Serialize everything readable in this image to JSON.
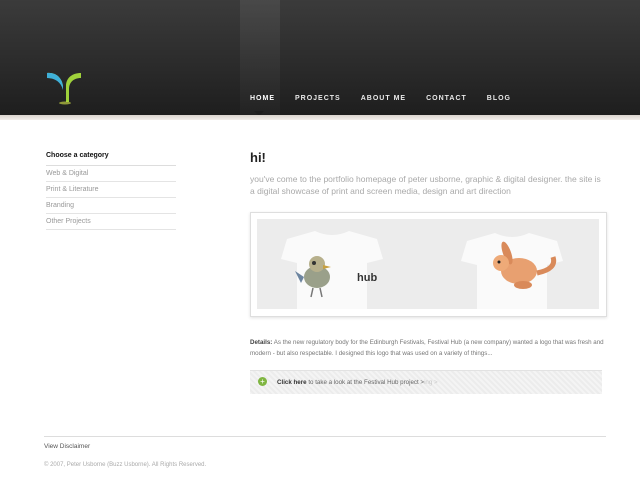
{
  "header": {
    "logo_icon": "y-logo-icon",
    "nav": [
      "HOME",
      "PROJECTS",
      "ABOUT ME",
      "CONTACT",
      "BLOG"
    ],
    "active": "HOME"
  },
  "sidebar": {
    "title": "Choose a category",
    "items": [
      "Web & Digital",
      "Print & Literature",
      "Branding",
      "Other Projects"
    ]
  },
  "main": {
    "greeting": "hi!",
    "intro": "you've come to the portfolio homepage of peter usborne, graphic & digital designer. the site is a digital showcase of print and screen media, design and art direction",
    "feature_logo_text": "hub",
    "details_label": "Details:",
    "details_text": "As the new regulatory body for the Edinburgh Festivals, Festival Hub (a new company) wanted a logo that was fresh and modern - but also respectable. I designed this logo that was used on a variety of things...",
    "cta_bold": "Click here",
    "cta_text": "to take a look at the Festival Hub project >",
    "cta_ghost": "ing >",
    "cta_icon": "plus-circle-icon"
  },
  "footer": {
    "disclaimer": "View Disclaimer",
    "copyright": "© 2007, Peter Usborne (Buzz Usborne). All Rights Reserved."
  }
}
